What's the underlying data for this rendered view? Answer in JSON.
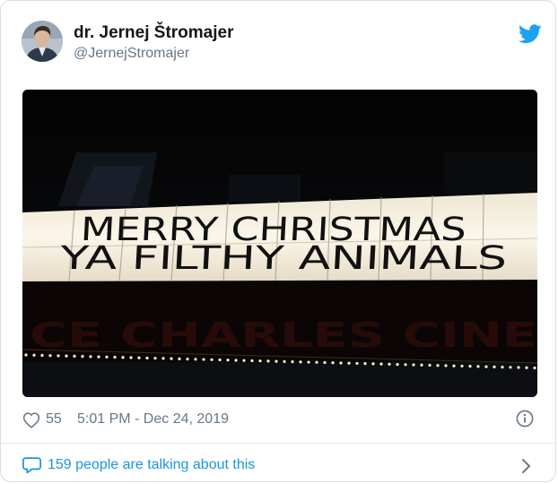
{
  "user": {
    "display_name": "dr. Jernej Štromajer",
    "handle": "@JernejStromajer"
  },
  "media": {
    "sign_line_1": "MERRY CHRISTMAS",
    "sign_line_2": "YA FILTHY ANIMALS",
    "marquee_text": "CE CHARLES CINE"
  },
  "footer": {
    "like_count": "55",
    "timestamp": "5:01 PM - Dec 24, 2019",
    "talking_text": "159 people are talking about this"
  },
  "colors": {
    "twitter_blue": "#1da1f2",
    "link_blue": "#1b95e0",
    "muted_gray": "#657786"
  }
}
